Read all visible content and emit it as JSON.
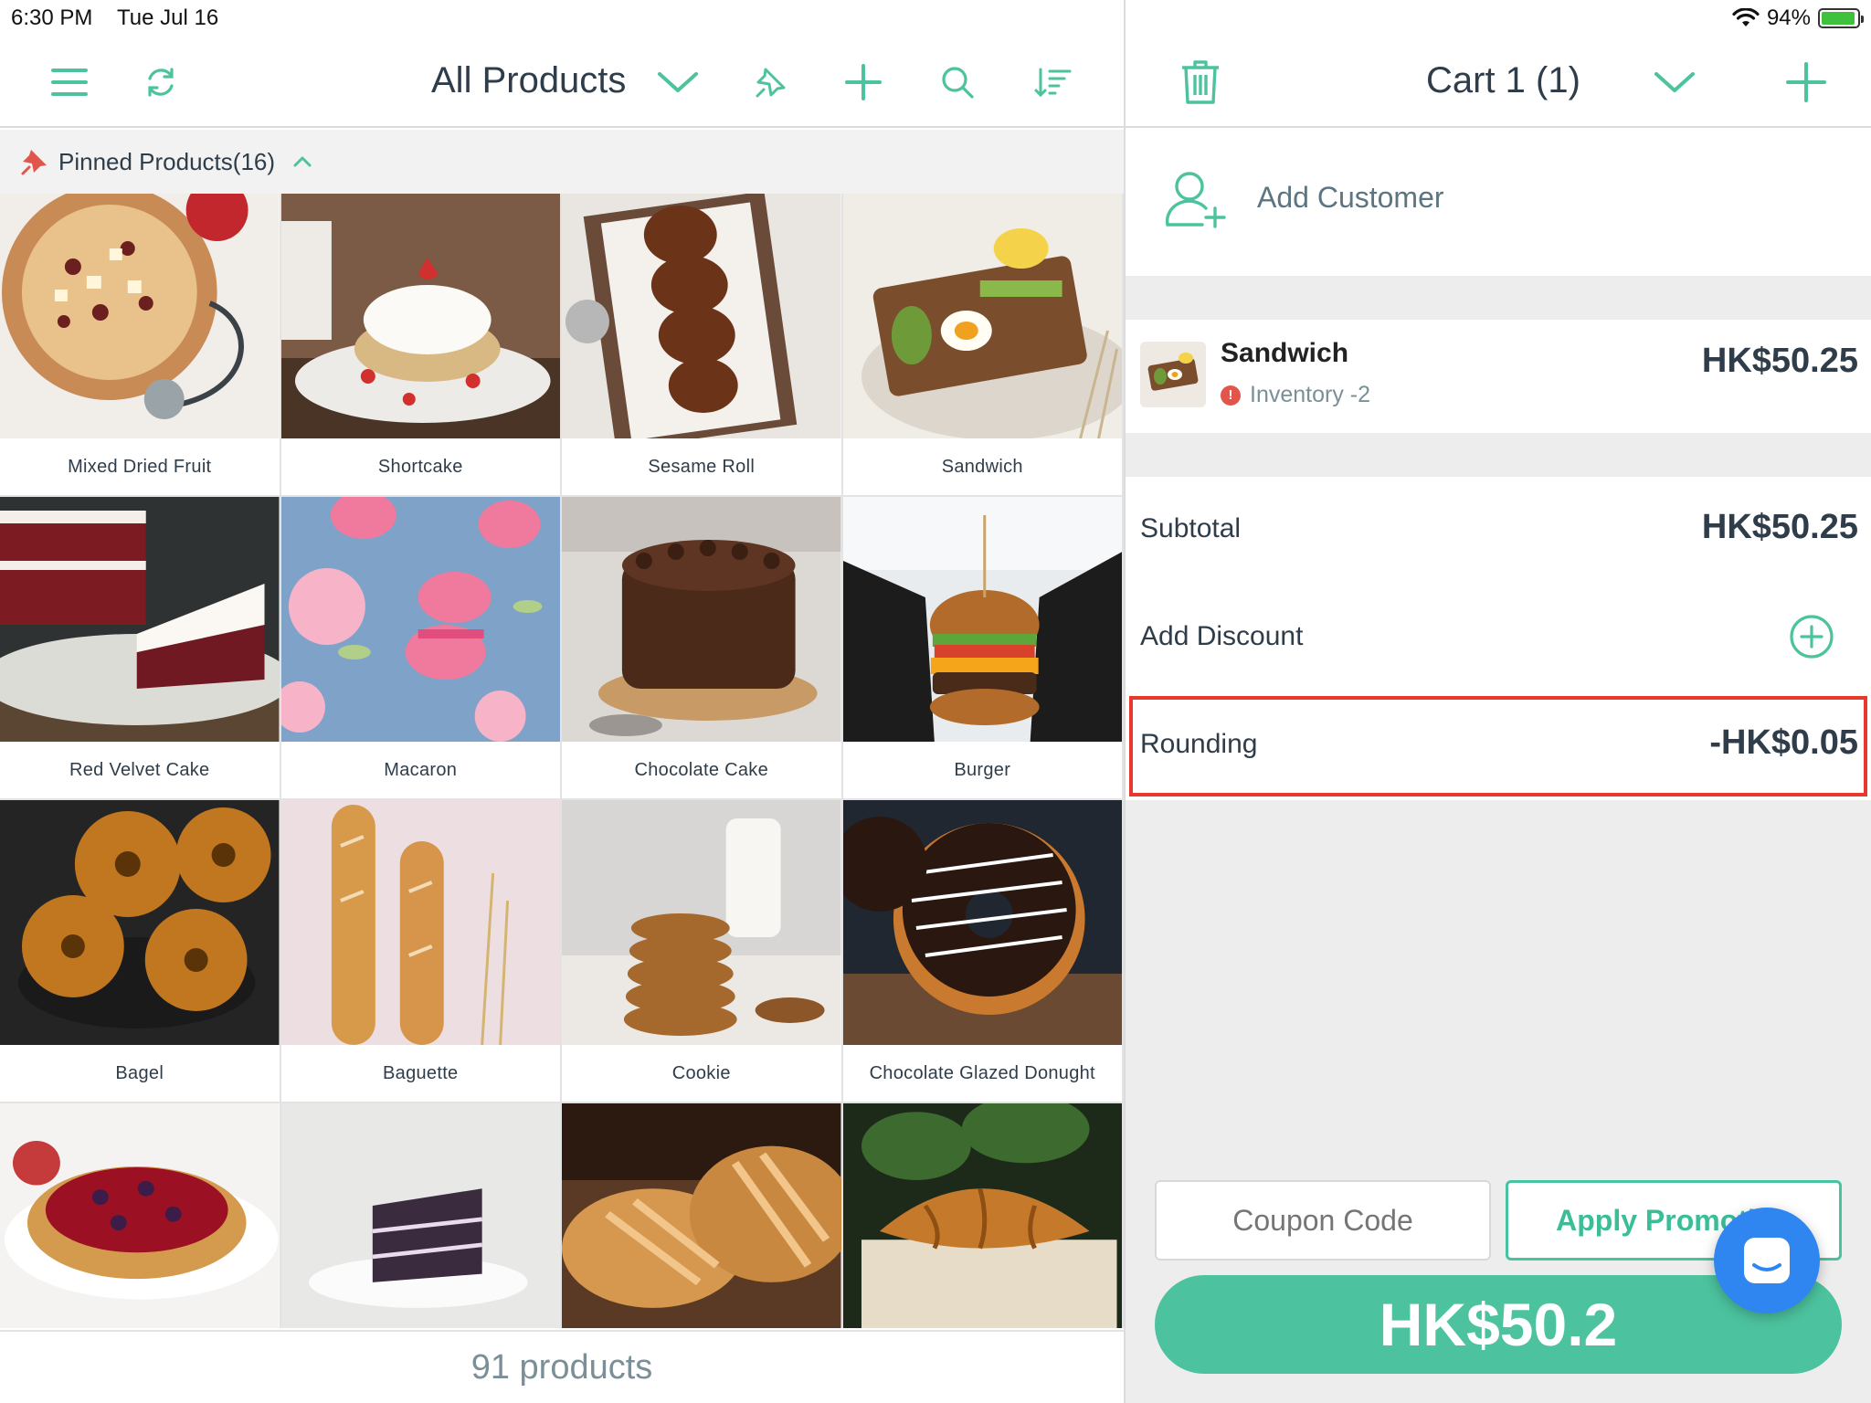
{
  "status": {
    "time": "6:30 PM",
    "date": "Tue Jul 16",
    "battery": "94%",
    "battery_level": 0.94
  },
  "left_header": {
    "title": "All Products",
    "icons": [
      "menu-icon",
      "refresh-icon",
      "chevron-down-icon",
      "pin-icon",
      "plus-icon",
      "search-icon",
      "sort-icon"
    ]
  },
  "pinned": {
    "label": "Pinned Products(16)"
  },
  "products": [
    {
      "name": "Mixed Dried Fruit"
    },
    {
      "name": "Shortcake"
    },
    {
      "name": "Sesame Roll"
    },
    {
      "name": "Sandwich"
    },
    {
      "name": "Red Velvet Cake"
    },
    {
      "name": "Macaron"
    },
    {
      "name": "Chocolate Cake"
    },
    {
      "name": "Burger"
    },
    {
      "name": "Bagel"
    },
    {
      "name": "Baguette"
    },
    {
      "name": "Cookie"
    },
    {
      "name": "Chocolate Glazed Donught"
    },
    {
      "name": ""
    },
    {
      "name": ""
    },
    {
      "name": ""
    },
    {
      "name": ""
    }
  ],
  "footer": {
    "count": "91 products"
  },
  "cart": {
    "title": "Cart 1 (1)",
    "add_customer": "Add Customer",
    "item": {
      "name": "Sandwich",
      "inventory": "Inventory -2",
      "price": "HK$50.25"
    },
    "subtotal_label": "Subtotal",
    "subtotal_value": "HK$50.25",
    "discount_label": "Add Discount",
    "rounding_label": "Rounding",
    "rounding_value": "-HK$0.05",
    "coupon_placeholder": "Coupon Code",
    "promo_label": "Apply Promotion",
    "total": "HK$50.2"
  },
  "colors": {
    "accent": "#4cc39e",
    "highlight": "#e8392f",
    "fab": "#2f86f0"
  }
}
